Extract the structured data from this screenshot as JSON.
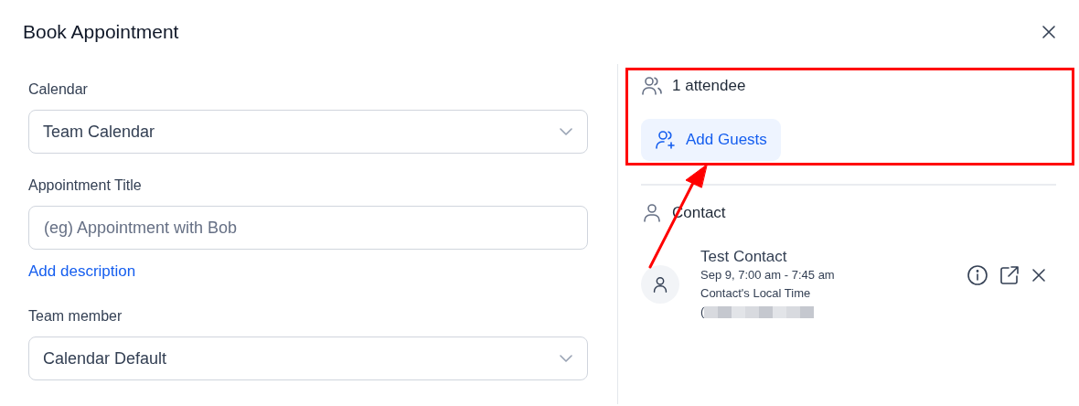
{
  "dialog": {
    "title": "Book Appointment"
  },
  "form": {
    "fields": [
      {
        "kind": "select",
        "label": "Calendar",
        "value": "Team Calendar"
      },
      {
        "kind": "text",
        "label": "Appointment Title",
        "placeholder": "(eg) Appointment with Bob"
      },
      {
        "kind": "link",
        "label": "Add description"
      },
      {
        "kind": "select",
        "label": "Team member",
        "value": "Calendar Default"
      }
    ]
  },
  "attendees": {
    "count_label": "1 attendee",
    "add_button": "Add Guests"
  },
  "contact": {
    "heading": "Contact",
    "name": "Test Contact",
    "time": "Sep 9, 7:00 am - 7:45 am",
    "timezone_label": "Contact's Local Time",
    "timezone_value": "(",
    "redacted": true
  },
  "annotations": {
    "highlight_box": true,
    "arrow": true
  }
}
